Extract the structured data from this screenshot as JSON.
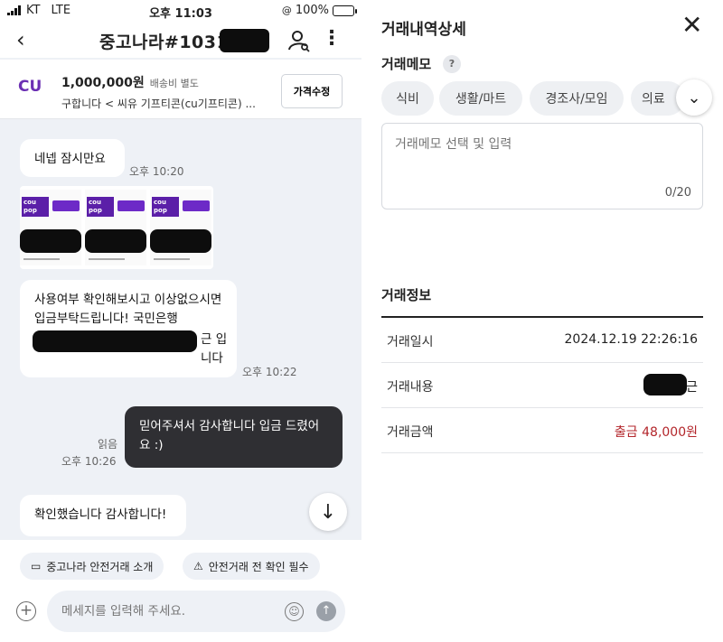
{
  "status_bar": {
    "carrier": "KT",
    "network": "LTE",
    "time": "오후 11:03",
    "battery": "100%"
  },
  "chat": {
    "title": "중고나라#1031",
    "product": {
      "logo_text": "CU",
      "price": "1,000,000원",
      "shipping": "배송비 별도",
      "name": "구합니다 < 씨유 기프티콘(cu기프티콘) ...",
      "price_edit_button": "가격수정"
    },
    "messages": [
      {
        "text": "네넵 잠시만요",
        "time": "오후 10:20"
      },
      {
        "text": "사용여부 확인해보시고 이상없으시면 입금부탁드립니다!  국민은행",
        "text_end": "근 입니다",
        "time": "오후 10:22"
      },
      {
        "text": "믿어주셔서 감사합니다 입금 드렸어요 :)",
        "read": "읽음",
        "time": "오후 10:26"
      },
      {
        "text": "확인했습니다 감사합니다!"
      }
    ],
    "coupon_label": "cou pop",
    "chips": [
      "중고나라 안전거래 소개",
      "안전거래 전 확인 필수"
    ],
    "input_placeholder": "메세지를 입력해 주세요."
  },
  "detail": {
    "title": "거래내역상세",
    "memo_label": "거래메모",
    "categories": [
      "식비",
      "생활/마트",
      "경조사/모임",
      "의료"
    ],
    "memo_placeholder": "거래메모 선택 및 입력",
    "memo_counter": "0/20",
    "info_title": "거래정보",
    "rows": [
      {
        "label": "거래일시",
        "value": "2024.12.19 22:26:16"
      },
      {
        "label": "거래내용",
        "value": "근"
      },
      {
        "label": "거래금액",
        "value": "출금 48,000원"
      }
    ]
  },
  "colors": {
    "chat_bg": "#eef1f6",
    "my_bubble": "#2f2f33",
    "amount_red": "#b3262b",
    "redaction": "#0d0d0d"
  }
}
